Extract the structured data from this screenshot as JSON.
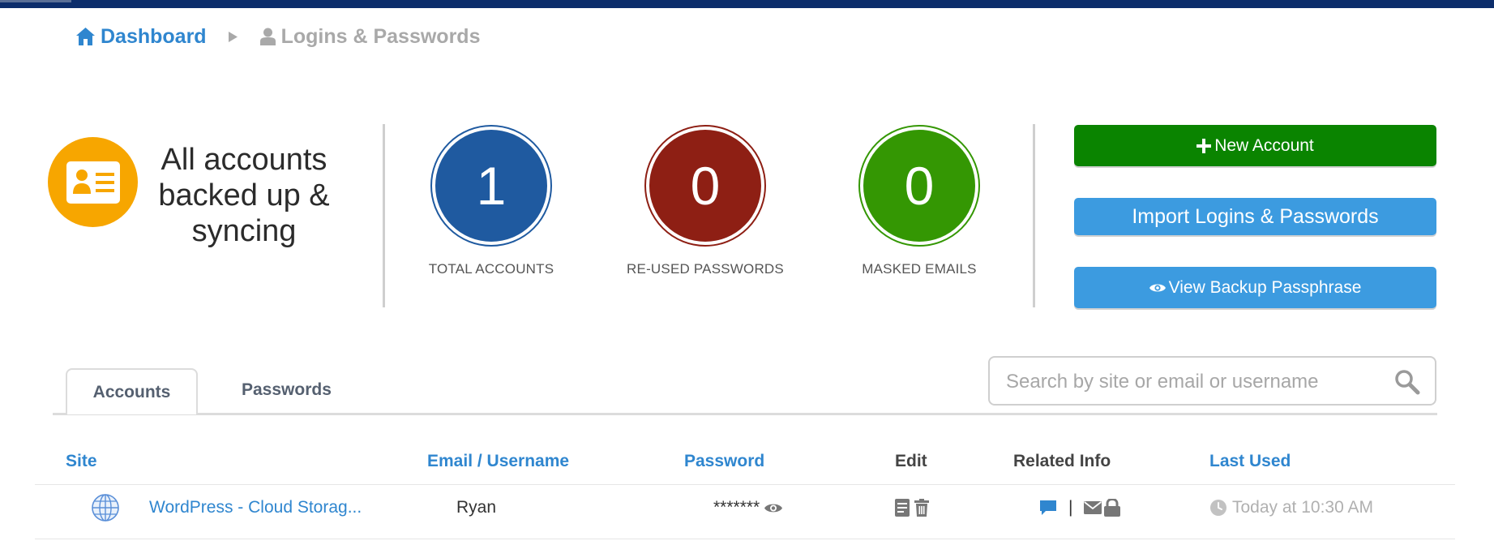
{
  "colors": {
    "topbar": "#0c2d6b",
    "link": "#2f86cf",
    "green": "#0a8400",
    "blue": "#3c9be0",
    "accent": "#f7a600"
  },
  "breadcrumb": {
    "home": "Dashboard",
    "current": "Logins & Passwords"
  },
  "status": {
    "line1": "All accounts",
    "line2": "backed up &",
    "line3": "syncing",
    "icon": "id-card-icon"
  },
  "stats": [
    {
      "value": "1",
      "label": "TOTAL ACCOUNTS",
      "color": "#1f5aa0"
    },
    {
      "value": "0",
      "label": "RE-USED PASSWORDS",
      "color": "#8e1f14"
    },
    {
      "value": "0",
      "label": "MASKED EMAILS",
      "color": "#349703"
    }
  ],
  "buttons": {
    "new_account": "New Account",
    "import": "Import Logins & Passwords",
    "backup": "View Backup Passphrase"
  },
  "tabs": {
    "accounts": "Accounts",
    "passwords": "Passwords"
  },
  "search": {
    "placeholder": "Search by site or email or username"
  },
  "table": {
    "headers": {
      "site": "Site",
      "email": "Email / Username",
      "password": "Password",
      "edit": "Edit",
      "related": "Related Info",
      "last_used": "Last Used"
    },
    "rows": [
      {
        "site": "WordPress - Cloud Storag...",
        "username": "Ryan",
        "password": "*******",
        "separator": "|",
        "last_used": "Today at 10:30 AM"
      }
    ]
  }
}
